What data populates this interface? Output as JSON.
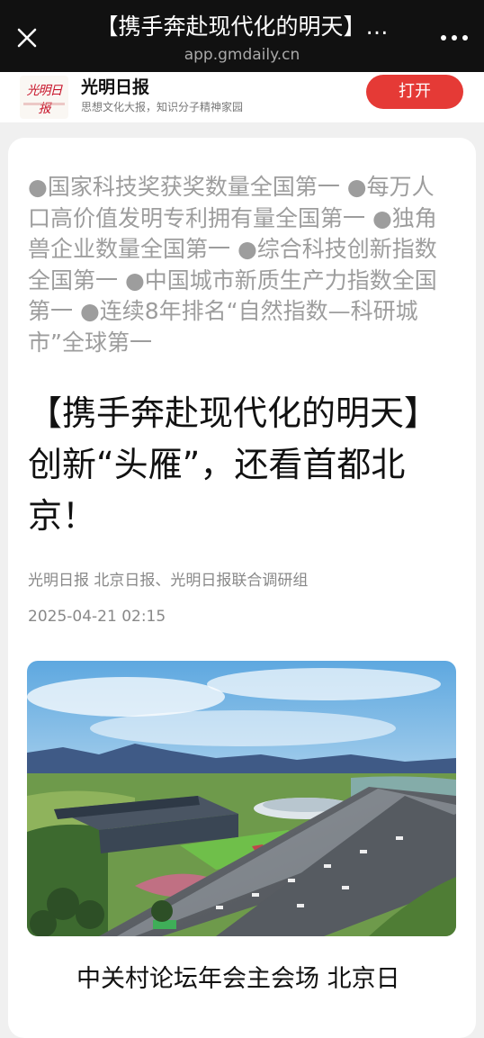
{
  "topbar": {
    "title": "【携手奔赴现代化的明天】…",
    "domain": "app.gmdaily.cn"
  },
  "app_banner": {
    "logo_text": "光明日报",
    "name": "光明日报",
    "slogan": "思想文化大报，知识分子精神家园",
    "open_label": "打开"
  },
  "article": {
    "summary": "●国家科技奖获奖数量全国第一 ●每万人口高价值发明专利拥有量全国第一 ●独角兽企业数量全国第一 ●综合科技创新指数全国第一 ●中国城市新质生产力指数全国第一 ●连续8年排名“自然指数—科研城市”全球第一",
    "headline": "【携手奔赴现代化的明天】创新“头雁”，还看首都北京！",
    "byline": "光明日报  北京日报、光明日报联合调研组",
    "date": "2025-04-21 02:15",
    "photo_caption": "中关村论坛年会主会场 北京日"
  },
  "colors": {
    "topbar_bg": "#111111",
    "accent_red": "#e53a36",
    "summary_gray": "#9d9d9d"
  },
  "icons": {
    "close": "close-icon",
    "more": "more-dots-icon"
  }
}
